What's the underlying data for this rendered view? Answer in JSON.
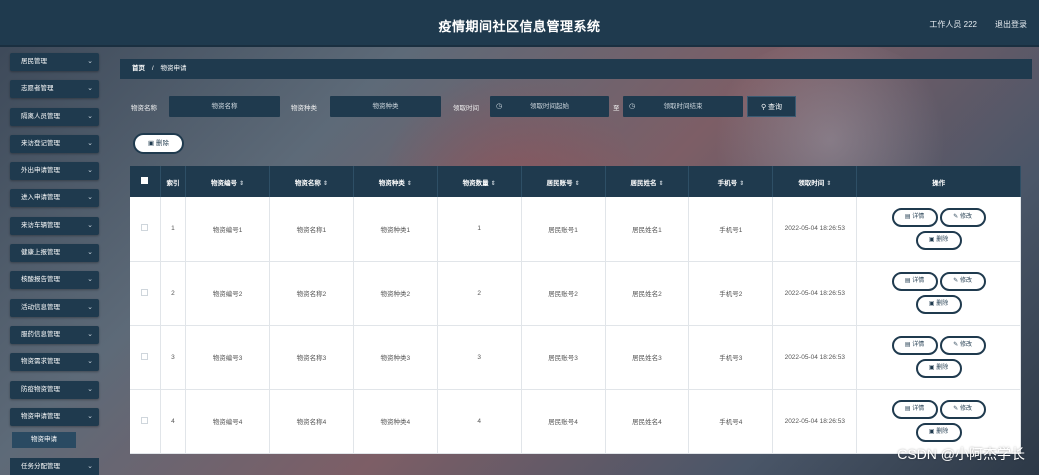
{
  "header": {
    "title": "疫情期间社区信息管理系统",
    "user": "工作人员 222",
    "logout": "退出登录"
  },
  "sidebar": {
    "items": [
      {
        "label": "居民管理"
      },
      {
        "label": "志愿者管理"
      },
      {
        "label": "隔离人员管理"
      },
      {
        "label": "来访登记管理"
      },
      {
        "label": "外出申请管理"
      },
      {
        "label": "进入申请管理"
      },
      {
        "label": "来访车辆管理"
      },
      {
        "label": "健康上报管理"
      },
      {
        "label": "核酸报告管理"
      },
      {
        "label": "活动信息管理"
      },
      {
        "label": "服药信息管理"
      },
      {
        "label": "物资需求管理"
      },
      {
        "label": "防疫物资管理"
      },
      {
        "label": "物资申请管理"
      }
    ],
    "active_sub": "物资申请",
    "last_item": "任务分配管理"
  },
  "breadcrumb": {
    "home": "首页",
    "separator": "/",
    "current": "物资申请"
  },
  "search": {
    "name_label": "物资名称",
    "name_placeholder": "物资名称",
    "type_label": "物资种类",
    "type_placeholder": "物资种类",
    "time_label": "领取时间",
    "time_start_placeholder": "领取时间起始",
    "to_label": "至",
    "time_end_placeholder": "领取时间结束",
    "query_button": "查询"
  },
  "toolbar": {
    "delete_label": "删除"
  },
  "table": {
    "columns": [
      "索引",
      "物资编号",
      "物资名称",
      "物资种类",
      "物资数量",
      "居民账号",
      "居民姓名",
      "手机号",
      "领取时间",
      "操作"
    ],
    "rows": [
      {
        "index": "1",
        "code": "物资编号1",
        "name": "物资名称1",
        "type": "物资种类1",
        "qty": "1",
        "account": "居民账号1",
        "resident": "居民姓名1",
        "phone": "手机号1",
        "time": "2022-05-04 18:26:53"
      },
      {
        "index": "2",
        "code": "物资编号2",
        "name": "物资名称2",
        "type": "物资种类2",
        "qty": "2",
        "account": "居民账号2",
        "resident": "居民姓名2",
        "phone": "手机号2",
        "time": "2022-05-04 18:26:53"
      },
      {
        "index": "3",
        "code": "物资编号3",
        "name": "物资名称3",
        "type": "物资种类3",
        "qty": "3",
        "account": "居民账号3",
        "resident": "居民姓名3",
        "phone": "手机号3",
        "time": "2022-05-04 18:26:53"
      },
      {
        "index": "4",
        "code": "物资编号4",
        "name": "物资名称4",
        "type": "物资种类4",
        "qty": "4",
        "account": "居民账号4",
        "resident": "居民姓名4",
        "phone": "手机号4",
        "time": "2022-05-04 18:26:53"
      }
    ],
    "actions": {
      "detail": "详情",
      "edit": "修改",
      "delete": "删除"
    }
  },
  "watermark": "CSDN @小阿杰学长",
  "colors": {
    "primary": "#1f3a4e",
    "table_bg": "#ffffff"
  }
}
